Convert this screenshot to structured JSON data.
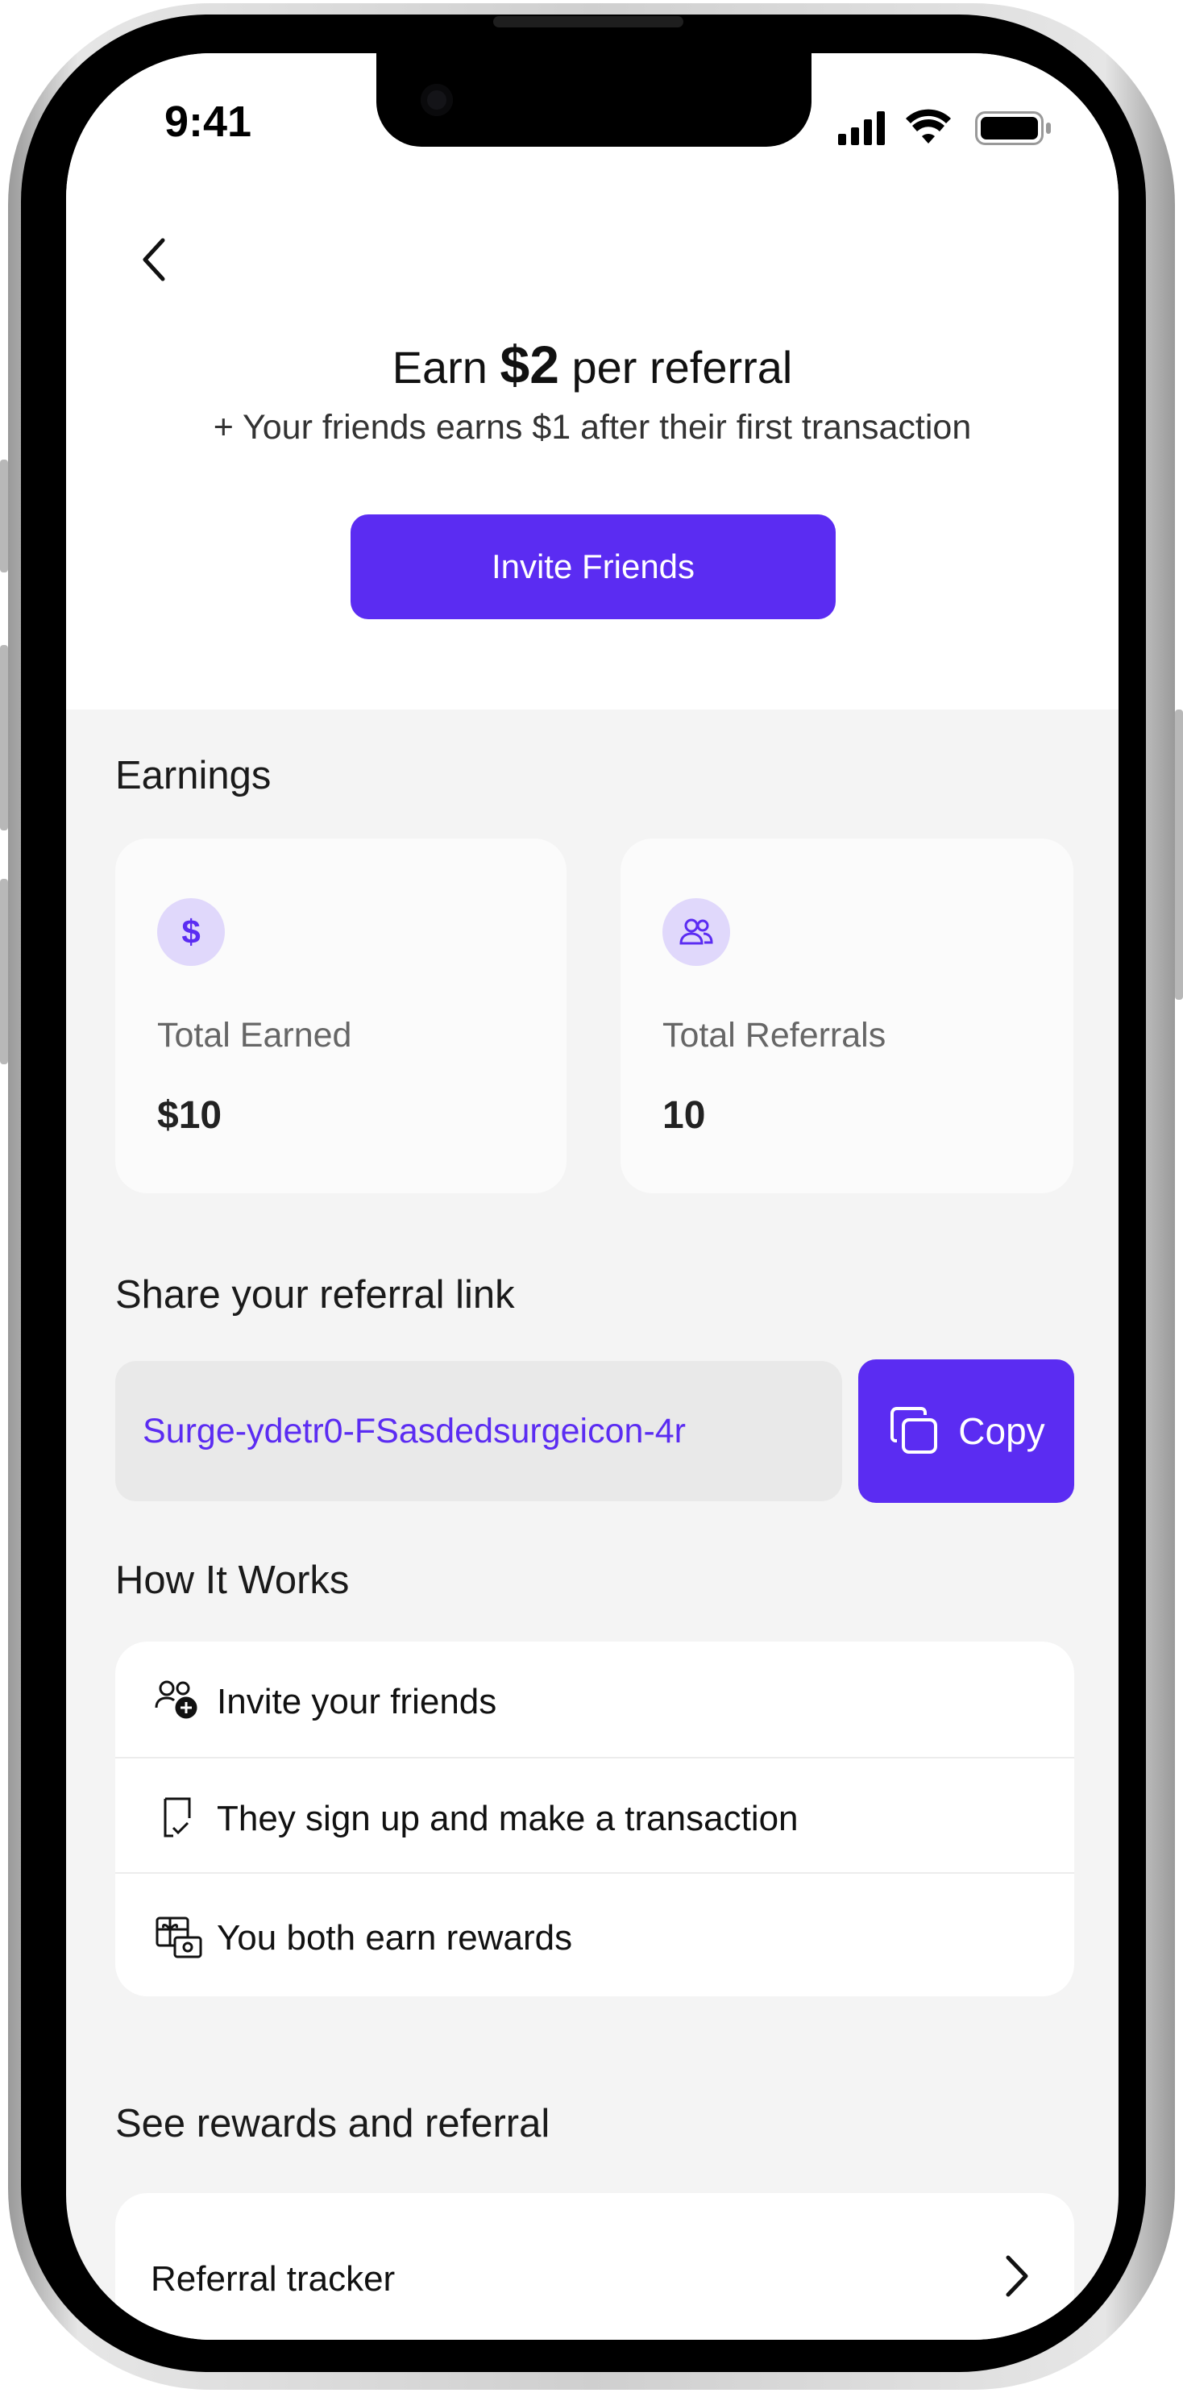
{
  "status_bar": {
    "time": "9:41"
  },
  "header": {
    "headline_prefix": "Earn",
    "headline_amount": "$2",
    "headline_suffix": "per referral",
    "subline": "+ Your friends earns $1 after their first transaction",
    "invite_button": "Invite Friends"
  },
  "earnings": {
    "title": "Earnings",
    "cards": [
      {
        "icon": "dollar-icon",
        "icon_glyph": "$",
        "label": "Total Earned",
        "value": "$10"
      },
      {
        "icon": "users-icon",
        "label": "Total Referrals",
        "value": "10"
      }
    ]
  },
  "share": {
    "title": "Share your referral link",
    "link": "Surge-ydetr0-FSasdedsurgeicon-4r",
    "copy_button": "Copy"
  },
  "how_it_works": {
    "title": "How It Works",
    "steps": [
      {
        "icon": "add-user-icon",
        "label": "Invite your friends"
      },
      {
        "icon": "receipt-check-icon",
        "label": "They sign up and make a transaction"
      },
      {
        "icon": "gift-money-icon",
        "label": "You both earn rewards"
      }
    ]
  },
  "rewards": {
    "title": "See rewards and referral",
    "items": [
      {
        "label": "Referral tracker"
      }
    ]
  },
  "colors": {
    "accent": "#5b2cf2",
    "background": "#f4f4f4",
    "icon_bg": "#e0d8fb"
  }
}
